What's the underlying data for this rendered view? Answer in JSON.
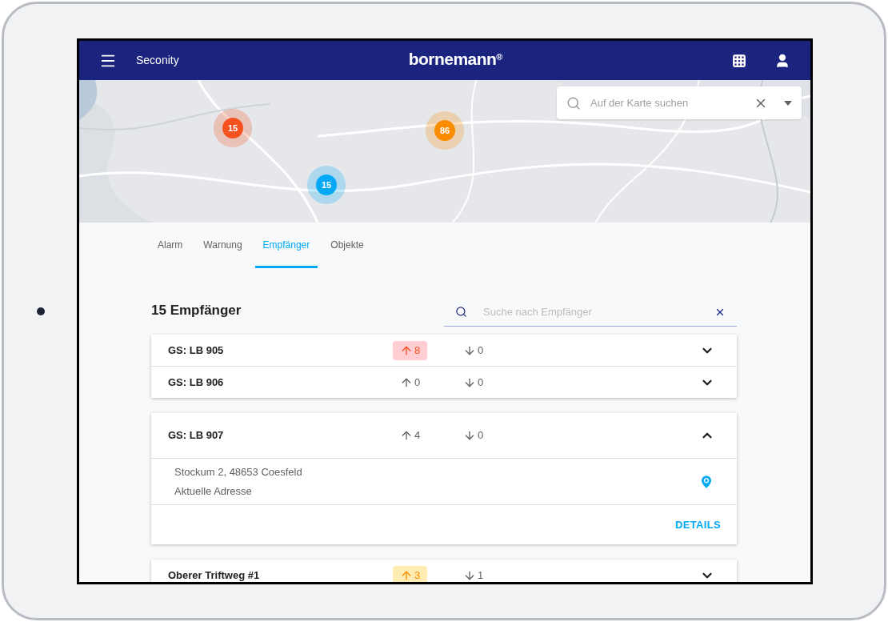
{
  "header": {
    "app_name": "Seconity",
    "logo": "bornemann",
    "logo_mark": "®"
  },
  "map": {
    "kind": "picture",
    "search": {
      "placeholder": "Auf der Karte suchen"
    },
    "clusters": [
      {
        "count": "15",
        "color": "#f4511e"
      },
      {
        "count": "86",
        "color": "#fb8c00"
      },
      {
        "count": "15",
        "color": "#03a9f4"
      }
    ]
  },
  "tabs": [
    {
      "label": "Alarm",
      "selected": false
    },
    {
      "label": "Warnung",
      "selected": false
    },
    {
      "label": "Empfänger",
      "selected": true
    },
    {
      "label": "Objekte",
      "selected": false
    }
  ],
  "list_title": "15 Empfänger",
  "search": {
    "placeholder": "Suche nach Empfänger"
  },
  "cards": [
    {
      "rows": [
        {
          "name": "GS: LB 905",
          "up": "8",
          "kind": "alarm",
          "down": "0",
          "expanded": false
        },
        {
          "name": "GS: LB 906",
          "up": "0",
          "kind": "normal",
          "down": "0",
          "expanded": false
        }
      ]
    },
    {
      "rows": [
        {
          "name": "GS: LB 907",
          "up": "4",
          "kind": "normal",
          "down": "0",
          "expanded": true,
          "address": "Stockum 2, 48653 Coesfeld",
          "address_note": "Aktuelle Adresse",
          "action": "DETAILS"
        }
      ]
    },
    {
      "rows": [
        {
          "name": "Oberer Triftweg #1",
          "up": "3",
          "kind": "warning",
          "down": "1",
          "expanded": false
        }
      ]
    }
  ]
}
